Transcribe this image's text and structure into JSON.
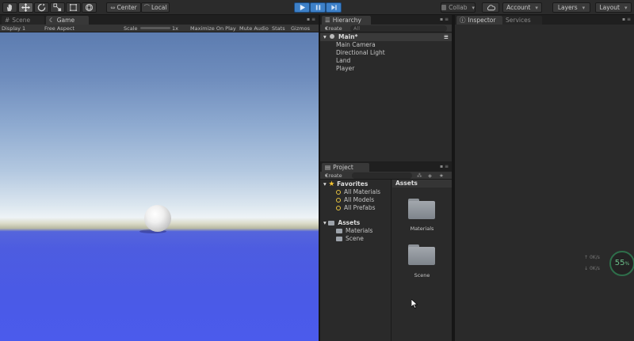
{
  "toolbar": {
    "tools": [
      "hand-icon",
      "move-icon",
      "rotate-icon",
      "scale-icon",
      "rect-icon",
      "transform-icon"
    ],
    "pivot": "Center",
    "space": "Local",
    "collab": "Collab",
    "account": "Account",
    "layers": "Layers",
    "layout": "Layout"
  },
  "game": {
    "scene_tab": "Scene",
    "game_tab": "Game",
    "display": "Display 1",
    "aspect": "Free Aspect",
    "scale_label": "Scale",
    "scale_value": "1x",
    "maximize": "Maximize On Play",
    "mute": "Mute Audio",
    "stats": "Stats",
    "gizmos": "Gizmos"
  },
  "hierarchy": {
    "tab": "Hierarchy",
    "create": "Create",
    "search_placeholder": "All",
    "scene": "Main*",
    "items": [
      "Main Camera",
      "Directional Light",
      "Land",
      "Player"
    ]
  },
  "project": {
    "tab": "Project",
    "create": "Create",
    "favorites_label": "Favorites",
    "favorites": [
      "All Materials",
      "All Models",
      "All Prefabs"
    ],
    "assets_label": "Assets",
    "asset_folders": [
      "Materials",
      "Scene"
    ],
    "breadcrumb": "Assets",
    "grid": [
      "Materials",
      "Scene"
    ]
  },
  "inspector": {
    "tab": "Inspector",
    "services_tab": "Services"
  },
  "perf": {
    "up": "0",
    "up_unit": "K/s",
    "down": "0",
    "down_unit": "K/s",
    "percent": "55",
    "percent_unit": "%"
  }
}
